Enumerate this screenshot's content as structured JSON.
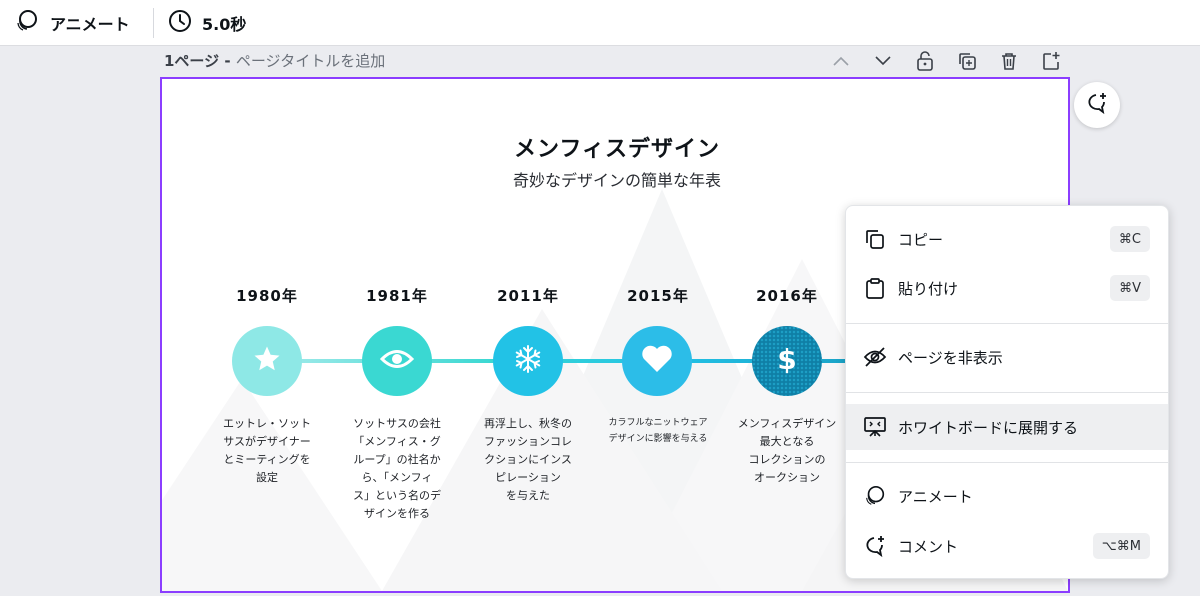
{
  "toolbar": {
    "animate_label": "アニメート",
    "duration_label": "5.0秒"
  },
  "page_header": {
    "page_label": "1ページ - ",
    "title_placeholder": "ページタイトルを追加"
  },
  "design": {
    "title": "メンフィスデザイン",
    "subtitle": "奇妙なデザインの簡単な年表",
    "events": [
      {
        "year": "1980年",
        "icon": "star-icon",
        "color": "#8ee8e6",
        "desc_lines": [
          "エットレ・ソット",
          "サスがデザイナー",
          "とミーティングを",
          "設定"
        ]
      },
      {
        "year": "1981年",
        "icon": "eye-icon",
        "color": "#3ad8d2",
        "desc_lines": [
          "ソットサスの会社",
          "「メンフィス・グ",
          "ループ」の社名か",
          "ら、「メンフィ",
          "ス」という名のデ",
          "ザインを作る"
        ]
      },
      {
        "year": "2011年",
        "icon": "snowflake-icon",
        "color": "#22c2e6",
        "desc_lines": [
          "再浮上し、秋冬の",
          "ファッションコレ",
          "クションにインス",
          "ピレーション",
          "を与えた"
        ]
      },
      {
        "year": "2015年",
        "icon": "heart-icon",
        "color": "#2cbde8",
        "desc_lines": [
          "カラフルなニットウェア",
          "デザインに影響を与える"
        ]
      },
      {
        "year": "2016年",
        "icon": "dollar-icon",
        "color": "#1aa0c4",
        "desc_lines": [
          "メンフィスデザイン",
          "最大となる",
          "コレクションの",
          "オークション"
        ]
      }
    ]
  },
  "context_menu": {
    "items": [
      {
        "label": "コピー",
        "icon": "copy-icon",
        "shortcut": "⌘C"
      },
      {
        "label": "貼り付け",
        "icon": "clipboard-icon",
        "shortcut": "⌘V"
      },
      {
        "label": "ページを非表示",
        "icon": "eye-slash-icon",
        "shortcut": ""
      },
      {
        "label": "ホワイトボードに展開する",
        "icon": "whiteboard-icon",
        "shortcut": ""
      },
      {
        "label": "アニメート",
        "icon": "animate-icon",
        "shortcut": ""
      },
      {
        "label": "コメント",
        "icon": "comment-icon",
        "shortcut": "⌥⌘M"
      }
    ]
  },
  "colors": {
    "accent": "#8b3dff",
    "highlight": "#eeeff1",
    "timeline_line": "#3fd6dc"
  }
}
